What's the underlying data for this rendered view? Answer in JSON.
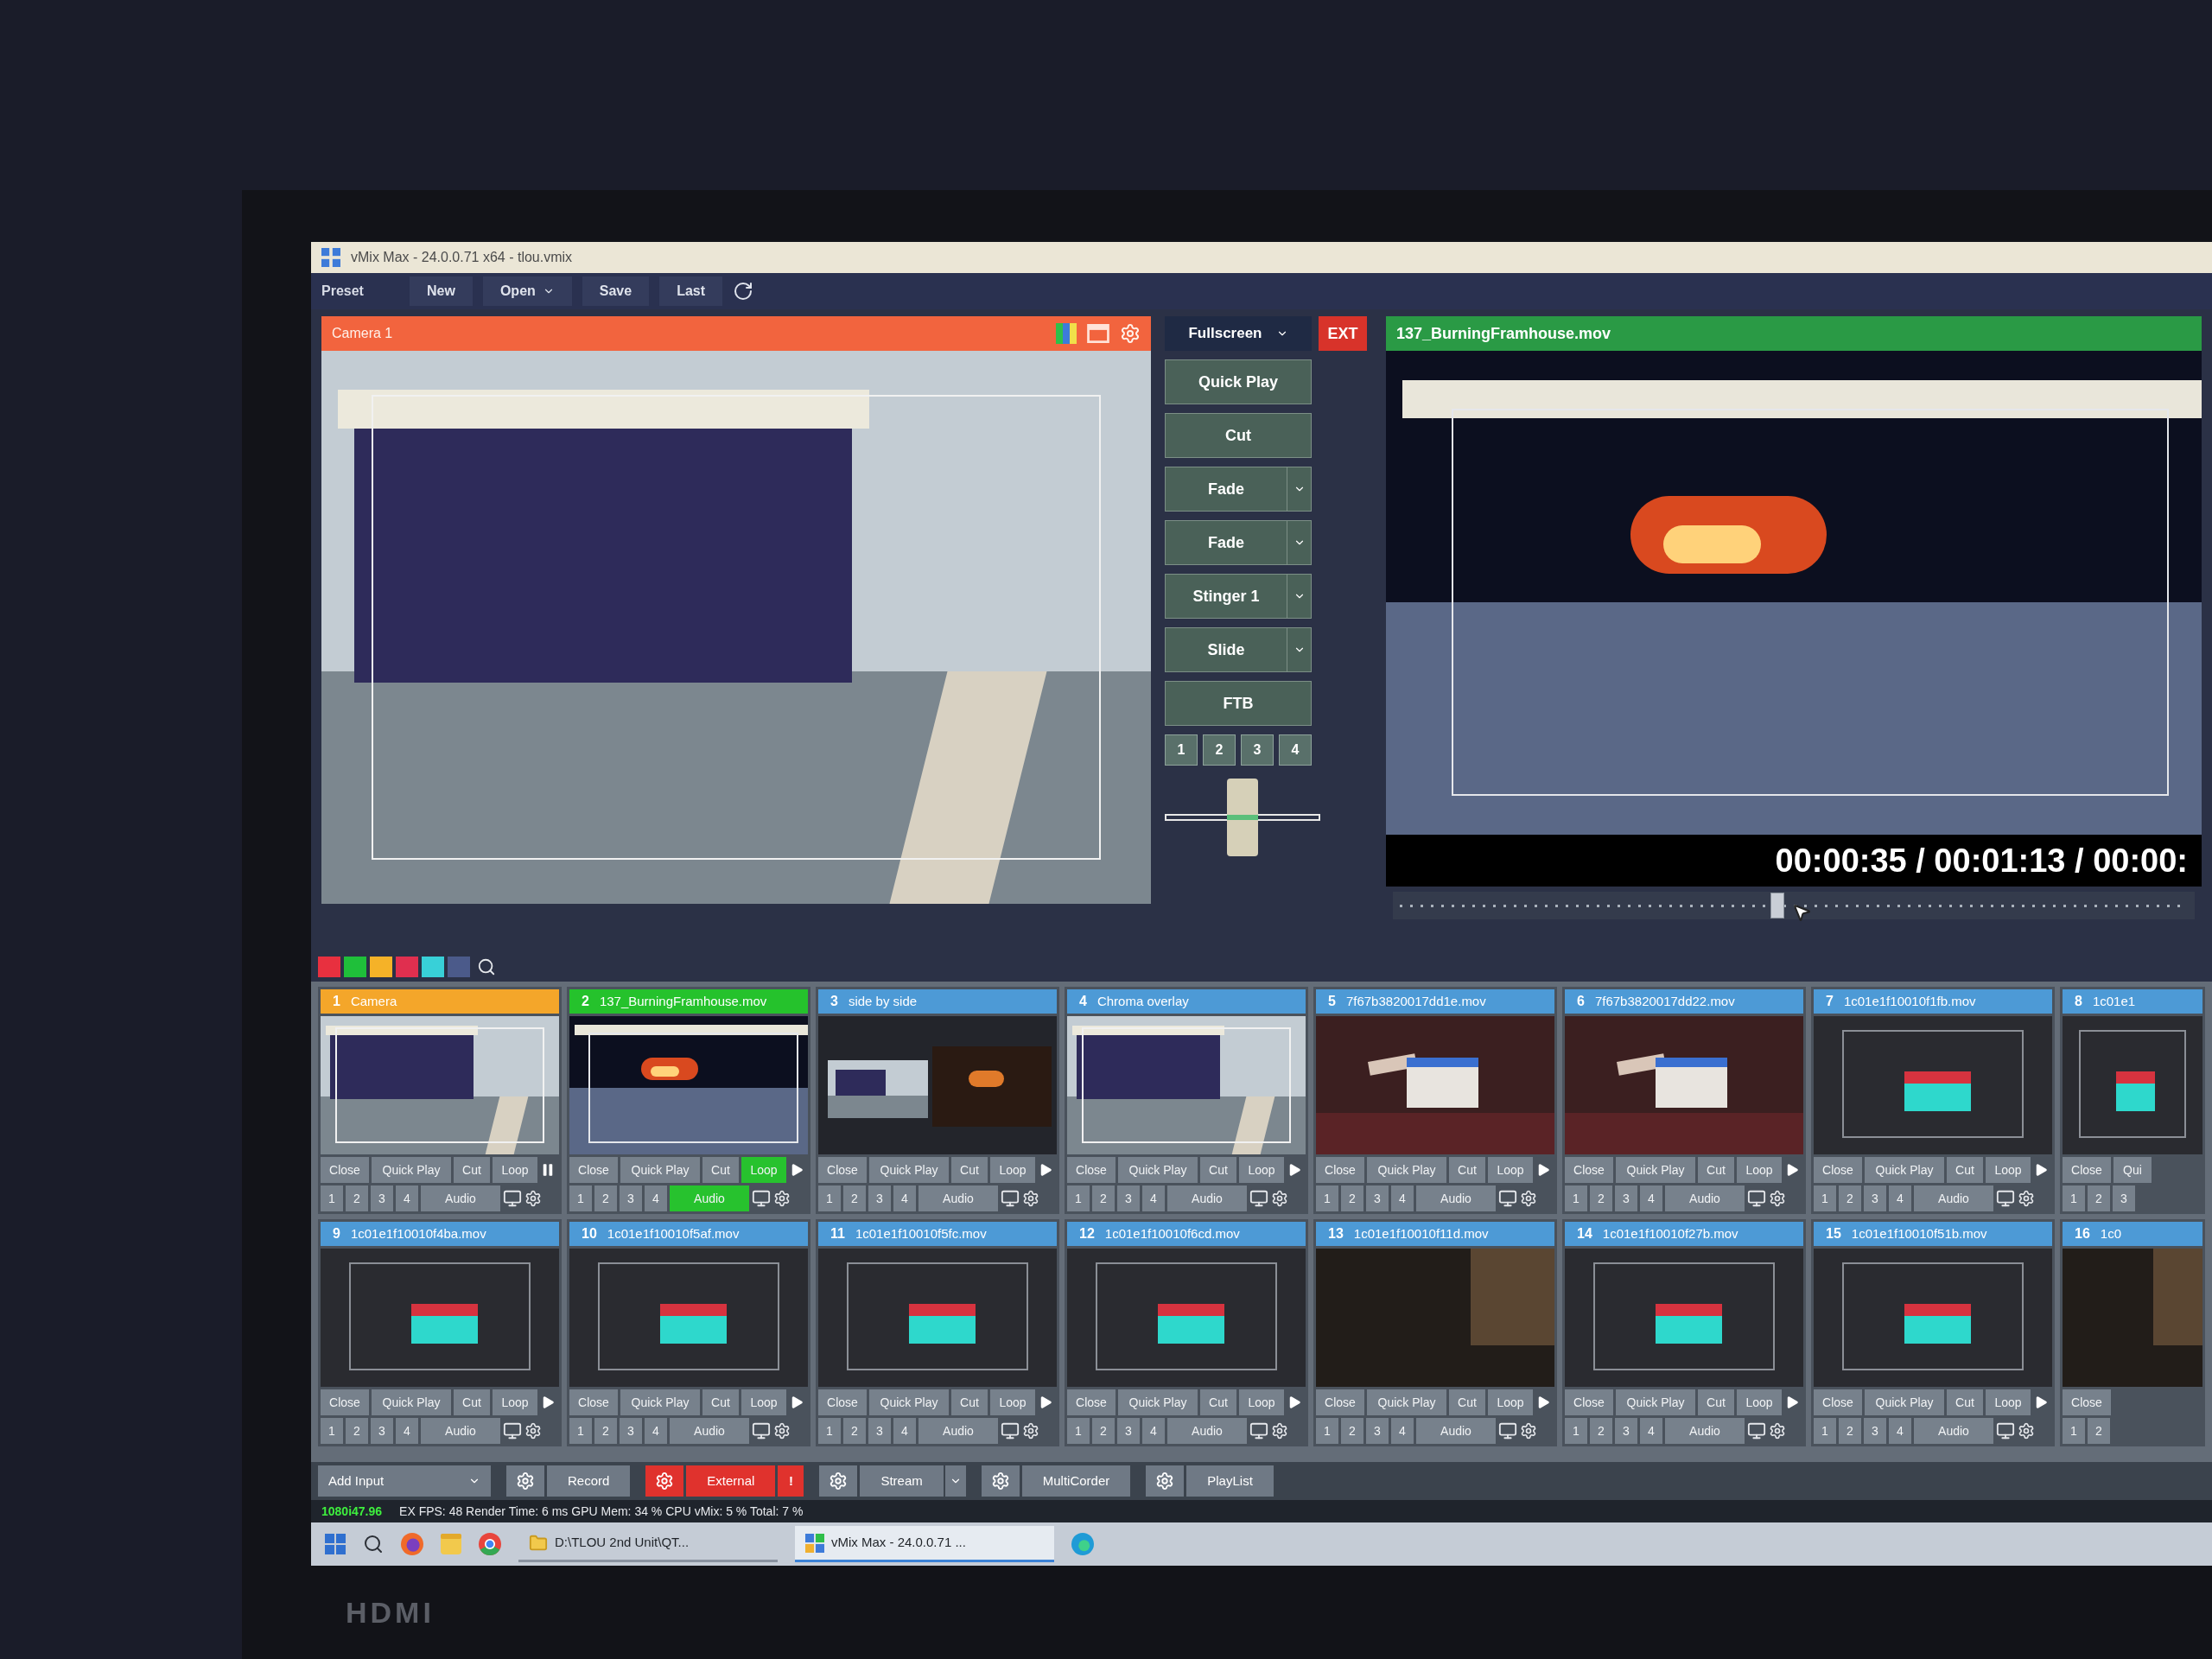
{
  "window": {
    "title": "vMix Max - 24.0.0.71 x64 - tlou.vmix"
  },
  "toolbar": {
    "label": "Preset",
    "buttons": [
      {
        "label": "New",
        "dropdown": false
      },
      {
        "label": "Open",
        "dropdown": true
      },
      {
        "label": "Save",
        "dropdown": false
      },
      {
        "label": "Last",
        "dropdown": false
      }
    ]
  },
  "preview": {
    "title": "Camera 1",
    "kind": "day"
  },
  "transitions": {
    "fullscreen": "Fullscreen",
    "ext": "EXT",
    "buttons": [
      {
        "label": "Quick Play",
        "dropdown": false
      },
      {
        "label": "Cut",
        "dropdown": false
      },
      {
        "label": "Fade",
        "dropdown": true
      },
      {
        "label": "Fade",
        "dropdown": true
      },
      {
        "label": "Stinger 1",
        "dropdown": true
      },
      {
        "label": "Slide",
        "dropdown": true
      },
      {
        "label": "FTB",
        "dropdown": false
      }
    ],
    "numbers": [
      "1",
      "2",
      "3",
      "4"
    ],
    "tbar": {
      "level": 0.5
    }
  },
  "output": {
    "title": "137_BurningFramhouse.mov",
    "kind": "fire",
    "time": "00:00:35 / 00:01:13 / 00:00:",
    "level": 0.48
  },
  "color_filters": [
    {
      "color": "#e8303f"
    },
    {
      "color": "#1fbf3a"
    },
    {
      "color": "#f5b228"
    },
    {
      "color": "#e02f4f"
    },
    {
      "color": "#38d0d8"
    },
    {
      "color": "#4b5a8a"
    }
  ],
  "inputs": [
    {
      "number": "1",
      "title": "Camera",
      "in_preview": true,
      "on_air": false,
      "kind": "day",
      "playing": true,
      "loop_on": false,
      "audio_on": false,
      "controls": {
        "close": "Close",
        "quick_play": "Quick Play",
        "cut": "Cut",
        "loop": "Loop",
        "audio": "Audio"
      },
      "overlays": [
        "1",
        "2",
        "3",
        "4"
      ]
    },
    {
      "number": "2",
      "title": "137_BurningFramhouse.mov",
      "in_preview": false,
      "on_air": true,
      "kind": "fire",
      "playing": false,
      "loop_on": true,
      "audio_on": true,
      "controls": {
        "close": "Close",
        "quick_play": "Quick Play",
        "cut": "Cut",
        "loop": "Loop",
        "audio": "Audio"
      },
      "overlays": [
        "1",
        "2",
        "3",
        "4"
      ]
    },
    {
      "number": "3",
      "title": "side by side",
      "in_preview": false,
      "on_air": false,
      "kind": "split",
      "playing": false,
      "loop_on": false,
      "audio_on": false,
      "controls": {
        "close": "Close",
        "quick_play": "Quick Play",
        "cut": "Cut",
        "loop": "Loop",
        "audio": "Audio"
      },
      "overlays": [
        "1",
        "2",
        "3",
        "4"
      ]
    },
    {
      "number": "4",
      "title": "Chroma overlay",
      "in_preview": false,
      "on_air": false,
      "kind": "day",
      "playing": false,
      "loop_on": false,
      "audio_on": false,
      "controls": {
        "close": "Close",
        "quick_play": "Quick Play",
        "cut": "Cut",
        "loop": "Loop",
        "audio": "Audio"
      },
      "overlays": [
        "1",
        "2",
        "3",
        "4"
      ]
    },
    {
      "number": "5",
      "title": "7f67b3820017dd1e.mov",
      "in_preview": false,
      "on_air": false,
      "kind": "clapper",
      "playing": false,
      "loop_on": false,
      "audio_on": false,
      "controls": {
        "close": "Close",
        "quick_play": "Quick Play",
        "cut": "Cut",
        "loop": "Loop",
        "audio": "Audio"
      },
      "overlays": [
        "1",
        "2",
        "3",
        "4"
      ]
    },
    {
      "number": "6",
      "title": "7f67b3820017dd22.mov",
      "in_preview": false,
      "on_air": false,
      "kind": "clapper",
      "playing": false,
      "loop_on": false,
      "audio_on": false,
      "controls": {
        "close": "Close",
        "quick_play": "Quick Play",
        "cut": "Cut",
        "loop": "Loop",
        "audio": "Audio"
      },
      "overlays": [
        "1",
        "2",
        "3",
        "4"
      ]
    },
    {
      "number": "7",
      "title": "1c01e1f10010f1fb.mov",
      "in_preview": false,
      "on_air": false,
      "kind": "slate",
      "playing": false,
      "loop_on": false,
      "audio_on": false,
      "controls": {
        "close": "Close",
        "quick_play": "Quick Play",
        "cut": "Cut",
        "loop": "Loop",
        "audio": "Audio"
      },
      "overlays": [
        "1",
        "2",
        "3",
        "4"
      ]
    },
    {
      "number": "8",
      "title": "1c01e1",
      "in_preview": false,
      "on_air": false,
      "kind": "slate",
      "controls": {
        "close": "Close",
        "quick_play": "Qui"
      },
      "overlays": [
        "1",
        "2",
        "3"
      ]
    },
    {
      "number": "9",
      "title": "1c01e1f10010f4ba.mov",
      "in_preview": false,
      "on_air": false,
      "kind": "slate",
      "playing": false,
      "loop_on": false,
      "audio_on": false,
      "controls": {
        "close": "Close",
        "quick_play": "Quick Play",
        "cut": "Cut",
        "loop": "Loop",
        "audio": "Audio"
      },
      "overlays": [
        "1",
        "2",
        "3",
        "4"
      ]
    },
    {
      "number": "10",
      "title": "1c01e1f10010f5af.mov",
      "in_preview": false,
      "on_air": false,
      "kind": "slate",
      "playing": false,
      "loop_on": false,
      "audio_on": false,
      "controls": {
        "close": "Close",
        "quick_play": "Quick Play",
        "cut": "Cut",
        "loop": "Loop",
        "audio": "Audio"
      },
      "overlays": [
        "1",
        "2",
        "3",
        "4"
      ]
    },
    {
      "number": "11",
      "title": "1c01e1f10010f5fc.mov",
      "in_preview": false,
      "on_air": false,
      "kind": "slate",
      "playing": false,
      "loop_on": false,
      "audio_on": false,
      "controls": {
        "close": "Close",
        "quick_play": "Quick Play",
        "cut": "Cut",
        "loop": "Loop",
        "audio": "Audio"
      },
      "overlays": [
        "1",
        "2",
        "3",
        "4"
      ]
    },
    {
      "number": "12",
      "title": "1c01e1f10010f6cd.mov",
      "in_preview": false,
      "on_air": false,
      "kind": "slate",
      "playing": false,
      "loop_on": false,
      "audio_on": false,
      "controls": {
        "close": "Close",
        "quick_play": "Quick Play",
        "cut": "Cut",
        "loop": "Loop",
        "audio": "Audio"
      },
      "overlays": [
        "1",
        "2",
        "3",
        "4"
      ]
    },
    {
      "number": "13",
      "title": "1c01e1f10010f11d.mov",
      "in_preview": false,
      "on_air": false,
      "kind": "dark",
      "playing": false,
      "loop_on": false,
      "audio_on": false,
      "controls": {
        "close": "Close",
        "quick_play": "Quick Play",
        "cut": "Cut",
        "loop": "Loop",
        "audio": "Audio"
      },
      "overlays": [
        "1",
        "2",
        "3",
        "4"
      ]
    },
    {
      "number": "14",
      "title": "1c01e1f10010f27b.mov",
      "in_preview": false,
      "on_air": false,
      "kind": "slate",
      "playing": false,
      "loop_on": false,
      "audio_on": false,
      "controls": {
        "close": "Close",
        "quick_play": "Quick Play",
        "cut": "Cut",
        "loop": "Loop",
        "audio": "Audio"
      },
      "overlays": [
        "1",
        "2",
        "3",
        "4"
      ]
    },
    {
      "number": "15",
      "title": "1c01e1f10010f51b.mov",
      "in_preview": false,
      "on_air": false,
      "kind": "slate",
      "playing": false,
      "loop_on": false,
      "audio_on": false,
      "controls": {
        "close": "Close",
        "quick_play": "Quick Play",
        "cut": "Cut",
        "loop": "Loop",
        "audio": "Audio"
      },
      "overlays": [
        "1",
        "2",
        "3",
        "4"
      ]
    },
    {
      "number": "16",
      "title": "1c0",
      "in_preview": false,
      "on_air": false,
      "kind": "dark",
      "controls": {
        "close": "Close"
      },
      "overlays": [
        "1",
        "2"
      ]
    }
  ],
  "bottom_bar": [
    {
      "kind": "add",
      "label": "Add Input"
    },
    {
      "kind": "output",
      "label": "Record",
      "on": false,
      "dropdown": false
    },
    {
      "kind": "output",
      "label": "External",
      "on": true,
      "dropdown": false,
      "alert": "!"
    },
    {
      "kind": "output",
      "label": "Stream",
      "on": false,
      "dropdown": true
    },
    {
      "kind": "output",
      "label": "MultiCorder",
      "on": false,
      "dropdown": false
    },
    {
      "kind": "output",
      "label": "PlayList",
      "on": false,
      "dropdown": false
    }
  ],
  "status_bar": {
    "format": "1080i47.96",
    "stats": "EX FPS: 48 Render Time: 6 ms GPU Mem: 34 % CPU vMix: 5 % Total: 7 %"
  },
  "taskbar": {
    "windows": [
      {
        "kind": "folder",
        "label": "D:\\TLOU 2nd Unit\\QT...",
        "active": false
      },
      {
        "kind": "app",
        "label": "vMix Max - 24.0.0.71 ...",
        "active": true
      }
    ]
  },
  "bezel": {
    "label": "HDMI"
  }
}
